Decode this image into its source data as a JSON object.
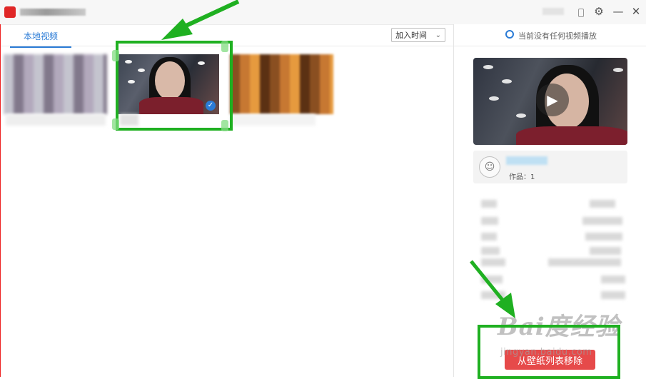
{
  "window": {
    "settings_icon": "gear-icon",
    "minimize_icon": "minimize-icon",
    "close_icon": "close-icon",
    "minimize_glyph": "—",
    "close_glyph": "✕",
    "settings_glyph": "⚙"
  },
  "left": {
    "tab_label": "本地视频",
    "sort": {
      "selected": "加入时间",
      "chevron": "⌄"
    }
  },
  "right": {
    "now_playing": "当前没有任何视频播放",
    "play_glyph": "▶",
    "author": {
      "works": "作品：1",
      "avatar_glyph": "☺"
    },
    "remove_button": "从壁纸列表移除"
  },
  "thumbnails": {
    "check_glyph": "✓"
  },
  "watermark": {
    "logo": "Bai度经验",
    "sub": "jingyan.baidu.com"
  },
  "colors": {
    "accent": "#2a7bd6",
    "highlight": "#1fb021",
    "remove": "#e64a4a"
  }
}
